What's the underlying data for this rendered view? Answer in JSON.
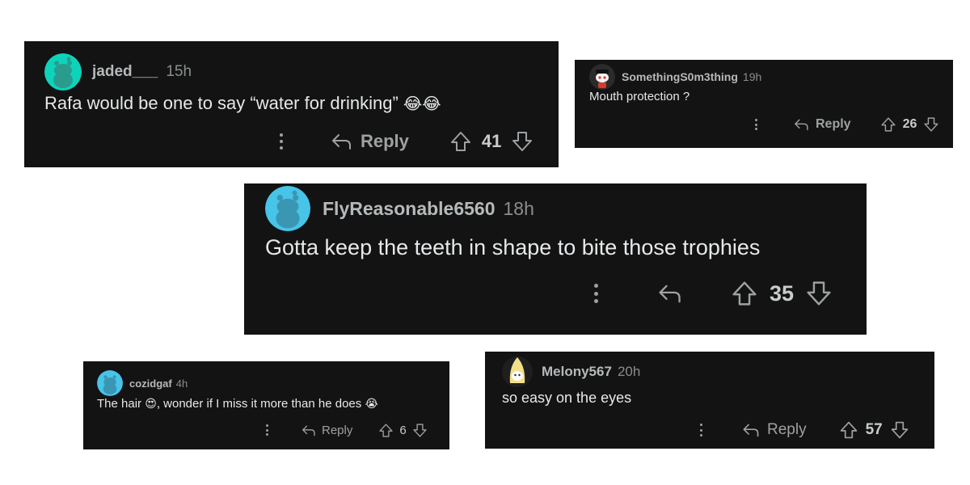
{
  "comments": [
    {
      "id": "c1",
      "username": "jaded___",
      "time": "15h",
      "avatar": "snoo-avatar-cyan",
      "text": "Rafa would be one to say “water for drinking”",
      "emoji": "😂😂",
      "reply_label": "Reply",
      "score": "41"
    },
    {
      "id": "c2",
      "username": "SomethingS0m3thing",
      "time": "19h",
      "avatar": "snoo-avatar-outfit",
      "text": "Mouth protection ?",
      "reply_label": "Reply",
      "score": "26"
    },
    {
      "id": "c3",
      "username": "FlyReasonable6560",
      "time": "18h",
      "avatar": "snoo-avatar-light-blue",
      "text": "Gotta keep the teeth in shape to bite those trophies",
      "score": "35"
    },
    {
      "id": "c4",
      "username": "cozidgaf",
      "time": "4h",
      "avatar": "snoo-avatar-light-blue",
      "text_part1": "The hair",
      "emoji1": "😍",
      "text_part2": ", wonder if I miss it more than he does",
      "emoji2": "😭",
      "reply_label": "Reply",
      "score": "6"
    },
    {
      "id": "c5",
      "username": "Melony567",
      "time": "20h",
      "avatar": "snoo-avatar-yellow-costume",
      "text": "so easy on the eyes",
      "reply_label": "Reply",
      "score": "57"
    }
  ],
  "colors": {
    "card_bg": "#131313",
    "body_text": "#e6e8ea",
    "meta_text": "#8a8d8f",
    "icon": "#9ea1a3",
    "avatar_cyan": "#0dd3bb",
    "avatar_light_blue": "#47c4e8"
  }
}
